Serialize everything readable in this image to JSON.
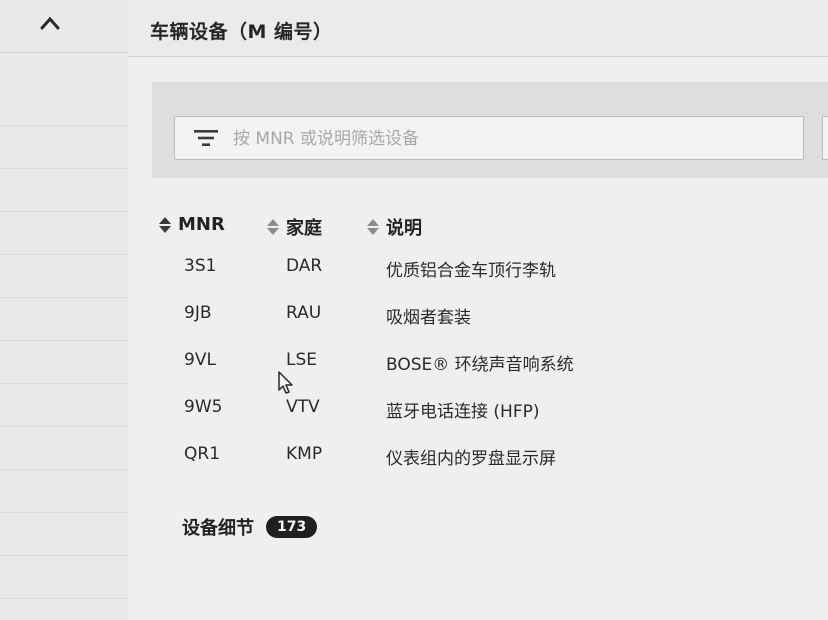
{
  "header": {
    "title": "车辆设备（M 编号）"
  },
  "filter": {
    "placeholder": "按 MNR 或说明筛选设备"
  },
  "table": {
    "columns": [
      {
        "label": "MNR",
        "sort": "active"
      },
      {
        "label": "家庭",
        "sort": "inactive"
      },
      {
        "label": "说明",
        "sort": "inactive"
      }
    ],
    "rows": [
      {
        "mnr": "3S1",
        "family": "DAR",
        "description": "优质铝合金车顶行李轨"
      },
      {
        "mnr": "9JB",
        "family": "RAU",
        "description": "吸烟者套装"
      },
      {
        "mnr": "9VL",
        "family": "LSE",
        "description": "BOSE® 环绕声音响系统"
      },
      {
        "mnr": "9W5",
        "family": "VTV",
        "description": "蓝牙电话连接 (HFP)"
      },
      {
        "mnr": "QR1",
        "family": "KMP",
        "description": "仪表组内的罗盘显示屏"
      }
    ]
  },
  "details": {
    "label": "设备细节",
    "count": "173"
  },
  "icons": {
    "sidebar_toggle": "chevron-up-icon",
    "filter": "filter-icon",
    "sort": "sort-icon"
  }
}
